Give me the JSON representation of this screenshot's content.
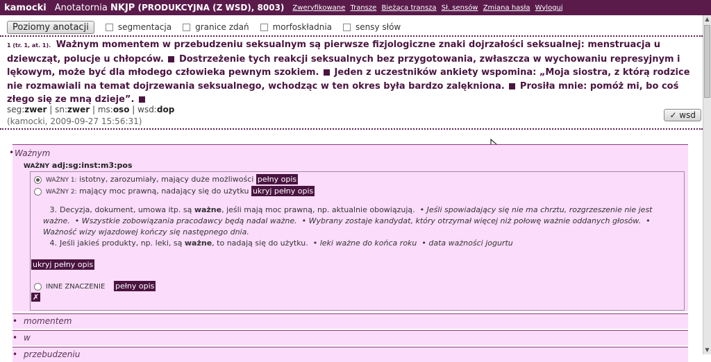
{
  "topbar": {
    "user": "kamocki",
    "app_name": "Anotatornia",
    "project_prefix": "NKJP",
    "project_rest": "(PRODUKCYJNA (Z WSD), 8003)",
    "links": [
      "Zweryfikowane",
      "Transze",
      "Bieżąca transza",
      "Sł. sensów",
      "Zmiana hasła",
      "Wyloguj"
    ],
    "bg_color": "#5a1b4b"
  },
  "toolbar": {
    "layers_button": "Poziomy anotacji",
    "checkboxes": [
      "segmentacja",
      "granice zdań",
      "morfoskładnia",
      "sensy słów"
    ]
  },
  "text": {
    "ref": "1 (tr. 1, at. 1).",
    "sentences": [
      "Ważnym momentem w przebudzeniu seksualnym są pierwsze fizjologiczne znaki dojrzałości seksualnej: menstruacja u dziewcząt, polucje u chłopców.",
      "Dostrzeżenie tych reakcji seksualnych bez przygotowania, zwłaszcza w wychowaniu represyjnym i lękowym, może być dla młodego człowieka pewnym szokiem.",
      "Jeden z uczestników ankiety wspomina: „Moja siostra, z którą rodzice nie rozmawiali na temat dojrzewania seksualnego, wchodząc w ten okres była bardzo zalękniona.",
      "Prosiła mnie: pomóż mi, bo coś złego się ze mną dzieje”."
    ]
  },
  "meta": {
    "seg_label": "seg:",
    "seg_val": "zwer",
    "sn_label": "sn:",
    "sn_val": "zwer",
    "ms_label": "ms:",
    "ms_val": "oso",
    "wsd_label": "wsd:",
    "wsd_val": "dop",
    "author_line": "(kamocki, 2009-09-27 15:56:31)",
    "wsd_button": "✓ wsd"
  },
  "panel": {
    "word": "Ważnym",
    "lemma_word": "WAŻNY",
    "lemma_tag": "adj:sg:inst:m3:pos",
    "senses": [
      {
        "lemma": "WAŻNY 1:",
        "definition": "istotny, zarozumiały, mający duże możliwości",
        "action": "pełny opis",
        "selected": true
      },
      {
        "lemma": "WAŻNY 2:",
        "definition": "mający moc prawną, nadający się do użytku",
        "action": "ukryj pełny opis",
        "selected": false
      }
    ],
    "definitions": [
      {
        "num": "3.",
        "pre": "Decyzja, dokument, umowa itp. są",
        "bold": "ważne",
        "post": ", jeśli mają moc prawną, np. aktualnie obowiązują.",
        "examples": [
          "Jeśli spowiadający się nie ma chrztu, rozgrzeszenie nie jest ważne.",
          "Wszystkie zobowiązania pracodawcy będą nadal ważne.",
          "Wybrany zostaje kandydat, który otrzymał więcej niż połowę ważnie oddanych głosów.",
          "Ważność wizy wjazdowej kończy się następnego dnia."
        ]
      },
      {
        "num": "4.",
        "pre": "Jeśli jakieś produkty, np. leki, są",
        "bold": "ważne",
        "post": ", to nadają się do użytku.",
        "examples": [
          "leki ważne do końca roku",
          "data ważności jogurtu"
        ]
      }
    ],
    "hide_label": "ukryj pełny opis",
    "other_label": "INNE ZNACZENIE",
    "other_action": "pełny opis",
    "x_label": "✗"
  },
  "words": [
    "momentem",
    "w",
    "przebudzeniu"
  ]
}
